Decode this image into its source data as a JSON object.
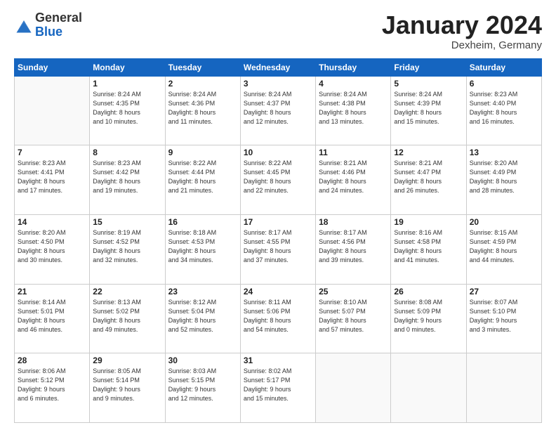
{
  "header": {
    "logo_general": "General",
    "logo_blue": "Blue",
    "month_title": "January 2024",
    "location": "Dexheim, Germany"
  },
  "weekdays": [
    "Sunday",
    "Monday",
    "Tuesday",
    "Wednesday",
    "Thursday",
    "Friday",
    "Saturday"
  ],
  "weeks": [
    [
      {
        "day": "",
        "info": ""
      },
      {
        "day": "1",
        "info": "Sunrise: 8:24 AM\nSunset: 4:35 PM\nDaylight: 8 hours\nand 10 minutes."
      },
      {
        "day": "2",
        "info": "Sunrise: 8:24 AM\nSunset: 4:36 PM\nDaylight: 8 hours\nand 11 minutes."
      },
      {
        "day": "3",
        "info": "Sunrise: 8:24 AM\nSunset: 4:37 PM\nDaylight: 8 hours\nand 12 minutes."
      },
      {
        "day": "4",
        "info": "Sunrise: 8:24 AM\nSunset: 4:38 PM\nDaylight: 8 hours\nand 13 minutes."
      },
      {
        "day": "5",
        "info": "Sunrise: 8:24 AM\nSunset: 4:39 PM\nDaylight: 8 hours\nand 15 minutes."
      },
      {
        "day": "6",
        "info": "Sunrise: 8:23 AM\nSunset: 4:40 PM\nDaylight: 8 hours\nand 16 minutes."
      }
    ],
    [
      {
        "day": "7",
        "info": "Sunrise: 8:23 AM\nSunset: 4:41 PM\nDaylight: 8 hours\nand 17 minutes."
      },
      {
        "day": "8",
        "info": "Sunrise: 8:23 AM\nSunset: 4:42 PM\nDaylight: 8 hours\nand 19 minutes."
      },
      {
        "day": "9",
        "info": "Sunrise: 8:22 AM\nSunset: 4:44 PM\nDaylight: 8 hours\nand 21 minutes."
      },
      {
        "day": "10",
        "info": "Sunrise: 8:22 AM\nSunset: 4:45 PM\nDaylight: 8 hours\nand 22 minutes."
      },
      {
        "day": "11",
        "info": "Sunrise: 8:21 AM\nSunset: 4:46 PM\nDaylight: 8 hours\nand 24 minutes."
      },
      {
        "day": "12",
        "info": "Sunrise: 8:21 AM\nSunset: 4:47 PM\nDaylight: 8 hours\nand 26 minutes."
      },
      {
        "day": "13",
        "info": "Sunrise: 8:20 AM\nSunset: 4:49 PM\nDaylight: 8 hours\nand 28 minutes."
      }
    ],
    [
      {
        "day": "14",
        "info": "Sunrise: 8:20 AM\nSunset: 4:50 PM\nDaylight: 8 hours\nand 30 minutes."
      },
      {
        "day": "15",
        "info": "Sunrise: 8:19 AM\nSunset: 4:52 PM\nDaylight: 8 hours\nand 32 minutes."
      },
      {
        "day": "16",
        "info": "Sunrise: 8:18 AM\nSunset: 4:53 PM\nDaylight: 8 hours\nand 34 minutes."
      },
      {
        "day": "17",
        "info": "Sunrise: 8:17 AM\nSunset: 4:55 PM\nDaylight: 8 hours\nand 37 minutes."
      },
      {
        "day": "18",
        "info": "Sunrise: 8:17 AM\nSunset: 4:56 PM\nDaylight: 8 hours\nand 39 minutes."
      },
      {
        "day": "19",
        "info": "Sunrise: 8:16 AM\nSunset: 4:58 PM\nDaylight: 8 hours\nand 41 minutes."
      },
      {
        "day": "20",
        "info": "Sunrise: 8:15 AM\nSunset: 4:59 PM\nDaylight: 8 hours\nand 44 minutes."
      }
    ],
    [
      {
        "day": "21",
        "info": "Sunrise: 8:14 AM\nSunset: 5:01 PM\nDaylight: 8 hours\nand 46 minutes."
      },
      {
        "day": "22",
        "info": "Sunrise: 8:13 AM\nSunset: 5:02 PM\nDaylight: 8 hours\nand 49 minutes."
      },
      {
        "day": "23",
        "info": "Sunrise: 8:12 AM\nSunset: 5:04 PM\nDaylight: 8 hours\nand 52 minutes."
      },
      {
        "day": "24",
        "info": "Sunrise: 8:11 AM\nSunset: 5:06 PM\nDaylight: 8 hours\nand 54 minutes."
      },
      {
        "day": "25",
        "info": "Sunrise: 8:10 AM\nSunset: 5:07 PM\nDaylight: 8 hours\nand 57 minutes."
      },
      {
        "day": "26",
        "info": "Sunrise: 8:08 AM\nSunset: 5:09 PM\nDaylight: 9 hours\nand 0 minutes."
      },
      {
        "day": "27",
        "info": "Sunrise: 8:07 AM\nSunset: 5:10 PM\nDaylight: 9 hours\nand 3 minutes."
      }
    ],
    [
      {
        "day": "28",
        "info": "Sunrise: 8:06 AM\nSunset: 5:12 PM\nDaylight: 9 hours\nand 6 minutes."
      },
      {
        "day": "29",
        "info": "Sunrise: 8:05 AM\nSunset: 5:14 PM\nDaylight: 9 hours\nand 9 minutes."
      },
      {
        "day": "30",
        "info": "Sunrise: 8:03 AM\nSunset: 5:15 PM\nDaylight: 9 hours\nand 12 minutes."
      },
      {
        "day": "31",
        "info": "Sunrise: 8:02 AM\nSunset: 5:17 PM\nDaylight: 9 hours\nand 15 minutes."
      },
      {
        "day": "",
        "info": ""
      },
      {
        "day": "",
        "info": ""
      },
      {
        "day": "",
        "info": ""
      }
    ]
  ]
}
